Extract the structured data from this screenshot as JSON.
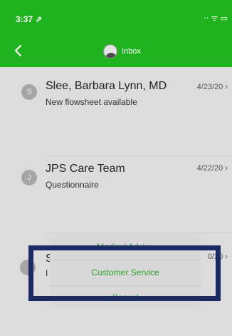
{
  "status": {
    "time": "3:37 ⇗",
    "icons": "⋅⋅ ᯤ ▭"
  },
  "nav": {
    "back_icon": "chevron-left",
    "title": "Inbox"
  },
  "messages": [
    {
      "initial": "S",
      "sender": "Slee, Barbara Lynn, MD",
      "subject": "New flowsheet available",
      "date": "4/23/20 ›"
    },
    {
      "initial": "J",
      "sender": "JPS Care Team",
      "subject": "Questionnaire",
      "date": "4/22/20 ›"
    },
    {
      "initial": "",
      "sender": "S",
      "subject": "I",
      "date": "0/20 ›"
    }
  ],
  "action_sheet": {
    "options": [
      "Medical Advice",
      "Customer Service",
      "Cancel"
    ]
  },
  "colors": {
    "header": "#1fb31f",
    "accent": "#2e9e2e",
    "highlight_border": "#1c2a63"
  }
}
